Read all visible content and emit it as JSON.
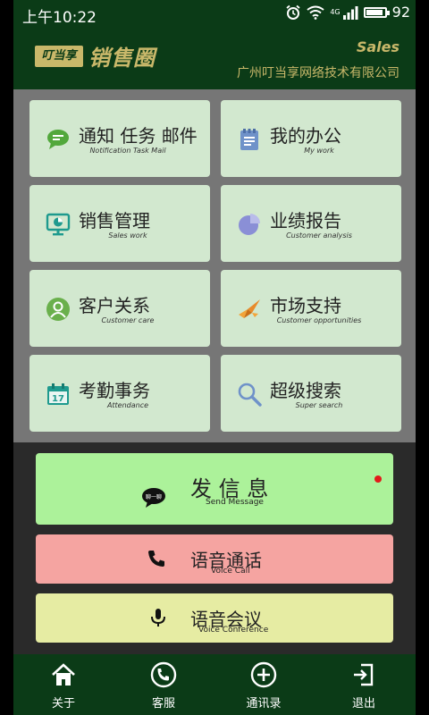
{
  "status_bar": {
    "time": "上午10:22",
    "network": "4G",
    "battery": "92",
    "battery_level": 0.92
  },
  "header": {
    "logo_mark": "叮当享",
    "app_name": "销售圈",
    "tagline": "Sales",
    "company": "广州叮当享网络技术有限公司"
  },
  "menu": [
    {
      "label": "通知 任务 邮件",
      "sub": "Notification Task Mail",
      "icon": "chat-bubble-icon",
      "color": "#52a83c"
    },
    {
      "label": "我的办公",
      "sub": "My work",
      "icon": "notepad-icon",
      "color": "#6f92c9"
    },
    {
      "label": "销售管理",
      "sub": "Sales work",
      "icon": "monitor-chart-icon",
      "color": "#1e9a8e"
    },
    {
      "label": "业绩报告",
      "sub": "Customer analysis",
      "icon": "pie-chart-icon",
      "color": "#8a8fd6"
    },
    {
      "label": "客户关系",
      "sub": "Customer care",
      "icon": "user-circle-icon",
      "color": "#6ab04c"
    },
    {
      "label": "市场支持",
      "sub": "Customer opportunities",
      "icon": "origami-crane-icon",
      "color": "#e88a2b"
    },
    {
      "label": "考勤事务",
      "sub": "Attendance",
      "icon": "calendar-icon",
      "color": "#1e9a8e"
    },
    {
      "label": "超级搜索",
      "sub": "Super search",
      "icon": "search-icon",
      "color": "#6f92c9"
    }
  ],
  "actions": {
    "message": {
      "label": "发 信 息",
      "sub": "Send Message",
      "bubble_text": "聊一聊",
      "color": "#acf29a",
      "unread_color": "#e21a1a"
    },
    "voice_call": {
      "label": "语音通话",
      "sub": "Voice Call",
      "color": "#f5a4a1"
    },
    "conference": {
      "label": "语音会议",
      "sub": "Voice Conference",
      "color": "#e6eca3"
    }
  },
  "bottom_nav": [
    {
      "label": "关于",
      "icon": "home-icon"
    },
    {
      "label": "客服",
      "icon": "phone-circle-icon"
    },
    {
      "label": "通讯录",
      "icon": "plus-circle-icon"
    },
    {
      "label": "退出",
      "icon": "exit-icon"
    }
  ],
  "colors": {
    "header_bg": "#0b3b17",
    "gold": "#c9b86a",
    "tile_bg": "#d2e8cf",
    "grid_bg": "#767676"
  }
}
